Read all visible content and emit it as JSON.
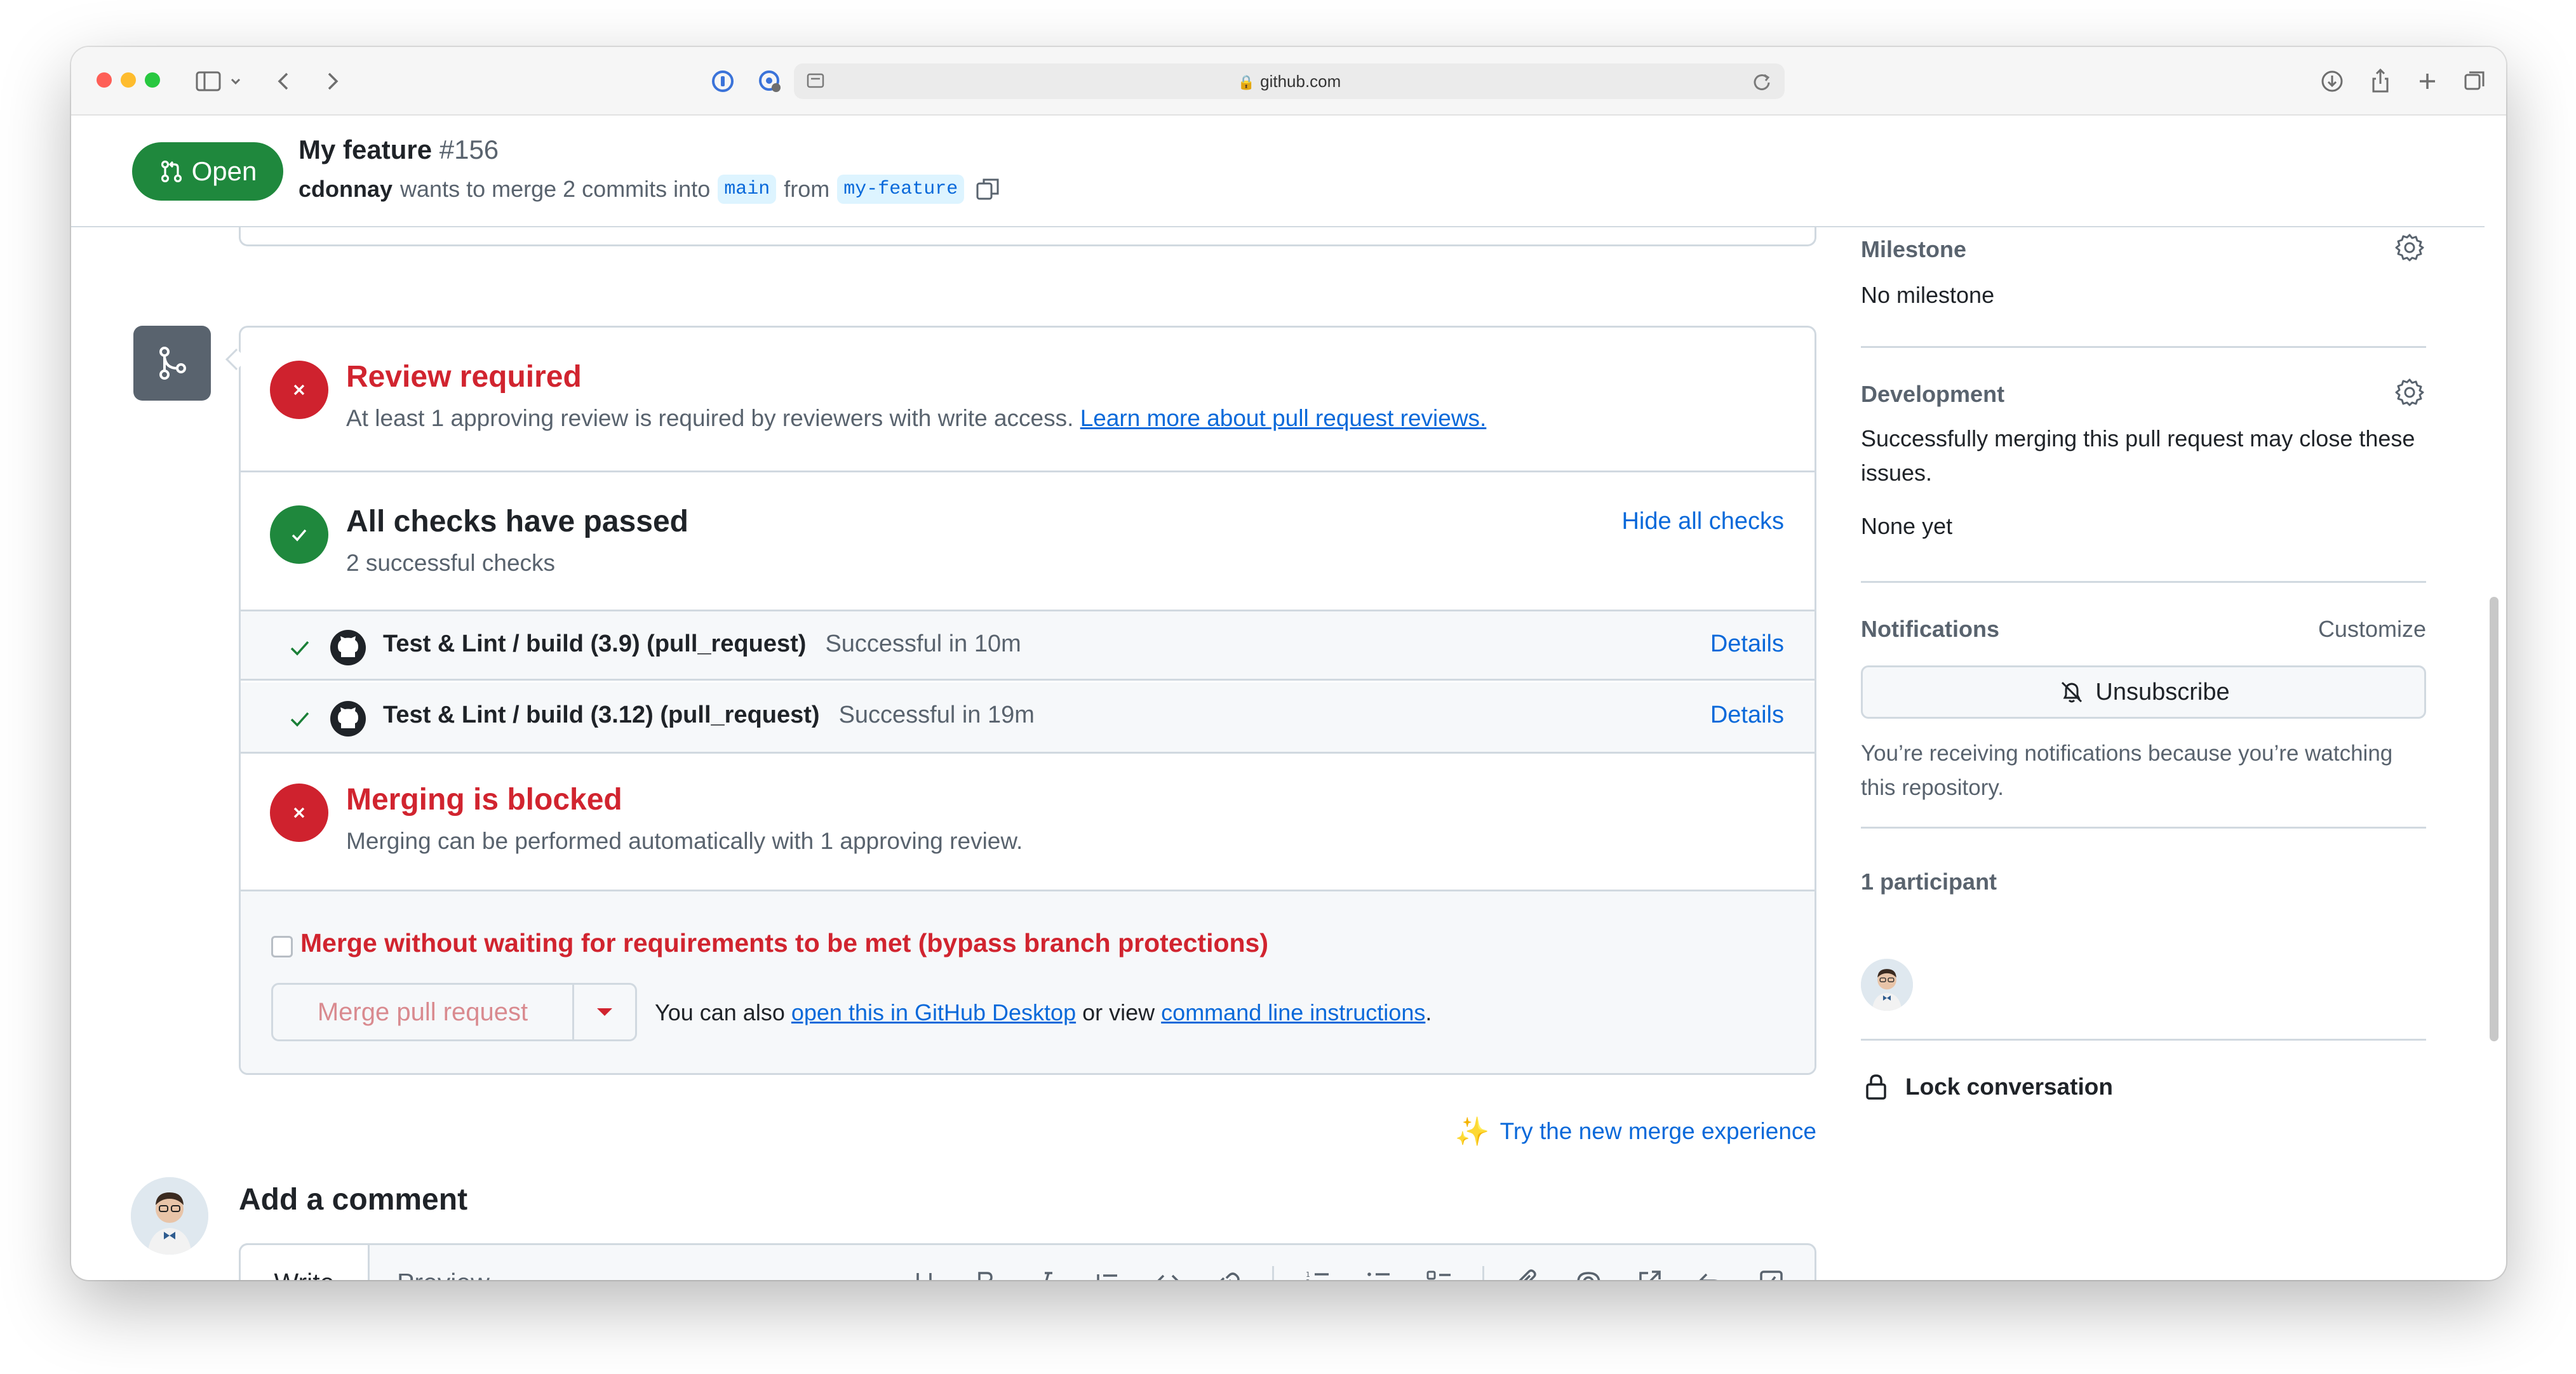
{
  "browser": {
    "url": "github.com"
  },
  "header": {
    "state_label": "Open",
    "title": "My feature",
    "number": "#156",
    "author": "cdonnay",
    "merge_text": "wants to merge 2 commits into",
    "base_branch": "main",
    "from_text": "from",
    "head_branch": "my-feature"
  },
  "merge_box": {
    "review": {
      "title": "Review required",
      "desc": "At least 1 approving review is required by reviewers with write access.",
      "link": "Learn more about pull request reviews."
    },
    "checks": {
      "title": "All checks have passed",
      "subtitle": "2 successful checks",
      "toggle": "Hide all checks",
      "items": [
        {
          "name": "Test & Lint / build (3.9) (pull_request)",
          "duration": "Successful in 10m",
          "details": "Details"
        },
        {
          "name": "Test & Lint / build (3.12) (pull_request)",
          "duration": "Successful in 19m",
          "details": "Details"
        }
      ]
    },
    "blocked": {
      "title": "Merging is blocked",
      "desc": "Merging can be performed automatically with 1 approving review."
    },
    "bypass_label": "Merge without waiting for requirements to be met (bypass branch protections)",
    "merge_button": "Merge pull request",
    "also_text_1": "You can also",
    "also_link_1": "open this in GitHub Desktop",
    "also_text_2": "or view",
    "also_link_2": "command line instructions",
    "also_text_3": ".",
    "try_new": "Try the new merge experience"
  },
  "comment": {
    "heading": "Add a comment",
    "tab_write": "Write",
    "tab_preview": "Preview"
  },
  "sidebar": {
    "milestone": {
      "heading": "Milestone",
      "value": "No milestone"
    },
    "development": {
      "heading": "Development",
      "desc": "Successfully merging this pull request may close these issues.",
      "value": "None yet"
    },
    "notifications": {
      "heading": "Notifications",
      "customize": "Customize",
      "button": "Unsubscribe",
      "desc": "You’re receiving notifications because you’re watching this repository."
    },
    "participants": {
      "heading": "1 participant"
    },
    "lock": "Lock conversation"
  },
  "colors": {
    "open_green": "#1f883d",
    "danger_red": "#d1242f",
    "link_blue": "#0969da",
    "muted": "#59636e"
  }
}
